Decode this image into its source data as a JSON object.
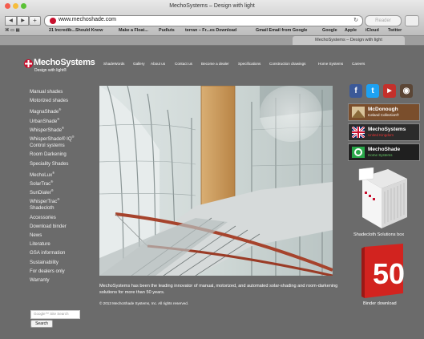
{
  "browser": {
    "window_title": "MechoSystems – Design with light",
    "url": "www.mechoshade.com",
    "reader_label": "Reader",
    "bookmarks": [
      "21 Incredib...Should Know",
      "Make a Float...",
      "Pudluts",
      "terran – Fr...es Download",
      "Gmail Email from Google",
      "Google",
      "Apple",
      "iCloud",
      "Twitter"
    ],
    "tab_title": "MechoSystems – Design with light"
  },
  "site": {
    "logo_name": "MechoSystems",
    "logo_tagline": "Design with light®",
    "top_nav": [
      "ShadeWords",
      "Gallery",
      "About us",
      "Contact us",
      "Become a dealer",
      "Specifications",
      "Construction drawings",
      "Home Systems",
      "Careers"
    ],
    "side_nav": [
      {
        "label": "Manual shades",
        "sup": ""
      },
      {
        "label": "Motorized shades",
        "sup": ""
      },
      {
        "label": "MagnaShade",
        "sup": "®"
      },
      {
        "label": "UrbanShade",
        "sup": "®"
      },
      {
        "label": "WhisperShade",
        "sup": "®"
      },
      {
        "label": "WhisperShade® IQ",
        "sup": "®"
      },
      {
        "label": "Control systems",
        "sup": ""
      },
      {
        "label": "Room Darkening",
        "sup": ""
      },
      {
        "label": "Speciality Shades",
        "sup": ""
      },
      {
        "label": "MechoLux",
        "sup": "®"
      },
      {
        "label": "SolarTrac",
        "sup": "®"
      },
      {
        "label": "SunDialer",
        "sup": "®"
      },
      {
        "label": "WhisperTrac",
        "sup": "®"
      },
      {
        "label": "Shadecloth",
        "sup": ""
      },
      {
        "label": "Accessories",
        "sup": ""
      },
      {
        "label": "Download binder",
        "sup": ""
      },
      {
        "label": "News",
        "sup": ""
      },
      {
        "label": "Literature",
        "sup": ""
      },
      {
        "label": "GSA information",
        "sup": ""
      },
      {
        "label": "Sustainability",
        "sup": ""
      },
      {
        "label": "For dealers only",
        "sup": ""
      },
      {
        "label": "Warranty",
        "sup": ""
      }
    ],
    "search_placeholder": "Google™ Site Search",
    "search_button": "Search",
    "tagline": "MechoSystems has been the leading innovator of manual, motorized, and automated solar-shading and room-darkening solutions for more than 50 years.",
    "copyright": "© 2013 MechoShade Systems, Inc. All rights reserved.",
    "social": [
      {
        "name": "facebook-icon",
        "glyph": "f",
        "color": "#3b5998"
      },
      {
        "name": "twitter-icon",
        "glyph": "t",
        "color": "#1da1f2"
      },
      {
        "name": "youtube-icon",
        "glyph": "▶",
        "color": "#c4302b"
      },
      {
        "name": "instagram-icon",
        "glyph": "◉",
        "color": "#5b4636"
      }
    ],
    "promos": [
      {
        "line1": "McDonough",
        "line2": "Iceland Collection®",
        "bg": "#7a4e2c"
      },
      {
        "line1": "MechoSystems",
        "line2": "United Kingdom",
        "bg": "#2b2b2b"
      },
      {
        "line1": "MechoShade",
        "line2": "Home Systems",
        "bg": "#1f1f1f"
      }
    ],
    "shadecloth_caption": "Shadecloth Solutions box",
    "binder_caption": "Binder download",
    "binder_number": "50"
  }
}
